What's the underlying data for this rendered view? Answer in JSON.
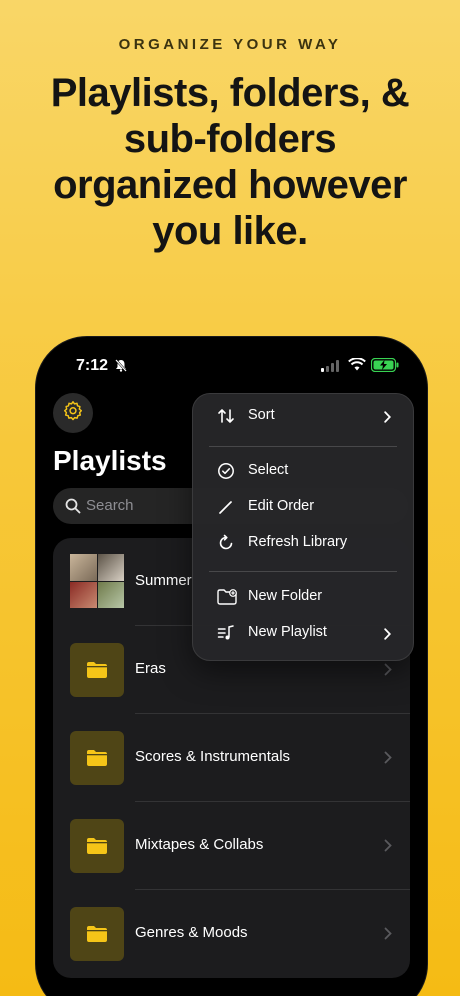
{
  "promo": {
    "eyebrow": "ORGANIZE YOUR WAY",
    "headline_line1": "Playlists, folders, &",
    "headline_line2": "sub-folders",
    "headline_line3": "organized however",
    "headline_line4": "you like."
  },
  "status_bar": {
    "time": "7:12"
  },
  "screen": {
    "title": "Playlists",
    "search_placeholder": "Search"
  },
  "list": {
    "items": [
      {
        "label": "Summer",
        "kind": "playlist"
      },
      {
        "label": "Eras",
        "kind": "folder"
      },
      {
        "label": "Scores & Instrumentals",
        "kind": "folder"
      },
      {
        "label": "Mixtapes & Collabs",
        "kind": "folder"
      },
      {
        "label": "Genres & Moods",
        "kind": "folder"
      }
    ]
  },
  "menu": {
    "items": [
      {
        "label": "Sort",
        "icon": "sort-icon",
        "has_submenu": true
      },
      {
        "label": "Select",
        "icon": "checkmark-circle-icon",
        "has_submenu": false
      },
      {
        "label": "Edit Order",
        "icon": "pencil-icon",
        "has_submenu": false
      },
      {
        "label": "Refresh Library",
        "icon": "refresh-icon",
        "has_submenu": false
      },
      {
        "label": "New Folder",
        "icon": "folder-plus-icon",
        "has_submenu": false
      },
      {
        "label": "New Playlist",
        "icon": "music-list-icon",
        "has_submenu": true
      }
    ]
  },
  "colors": {
    "accent": "#f5c518",
    "background": "#f7c83a",
    "folder_tile": "#4f4516"
  }
}
